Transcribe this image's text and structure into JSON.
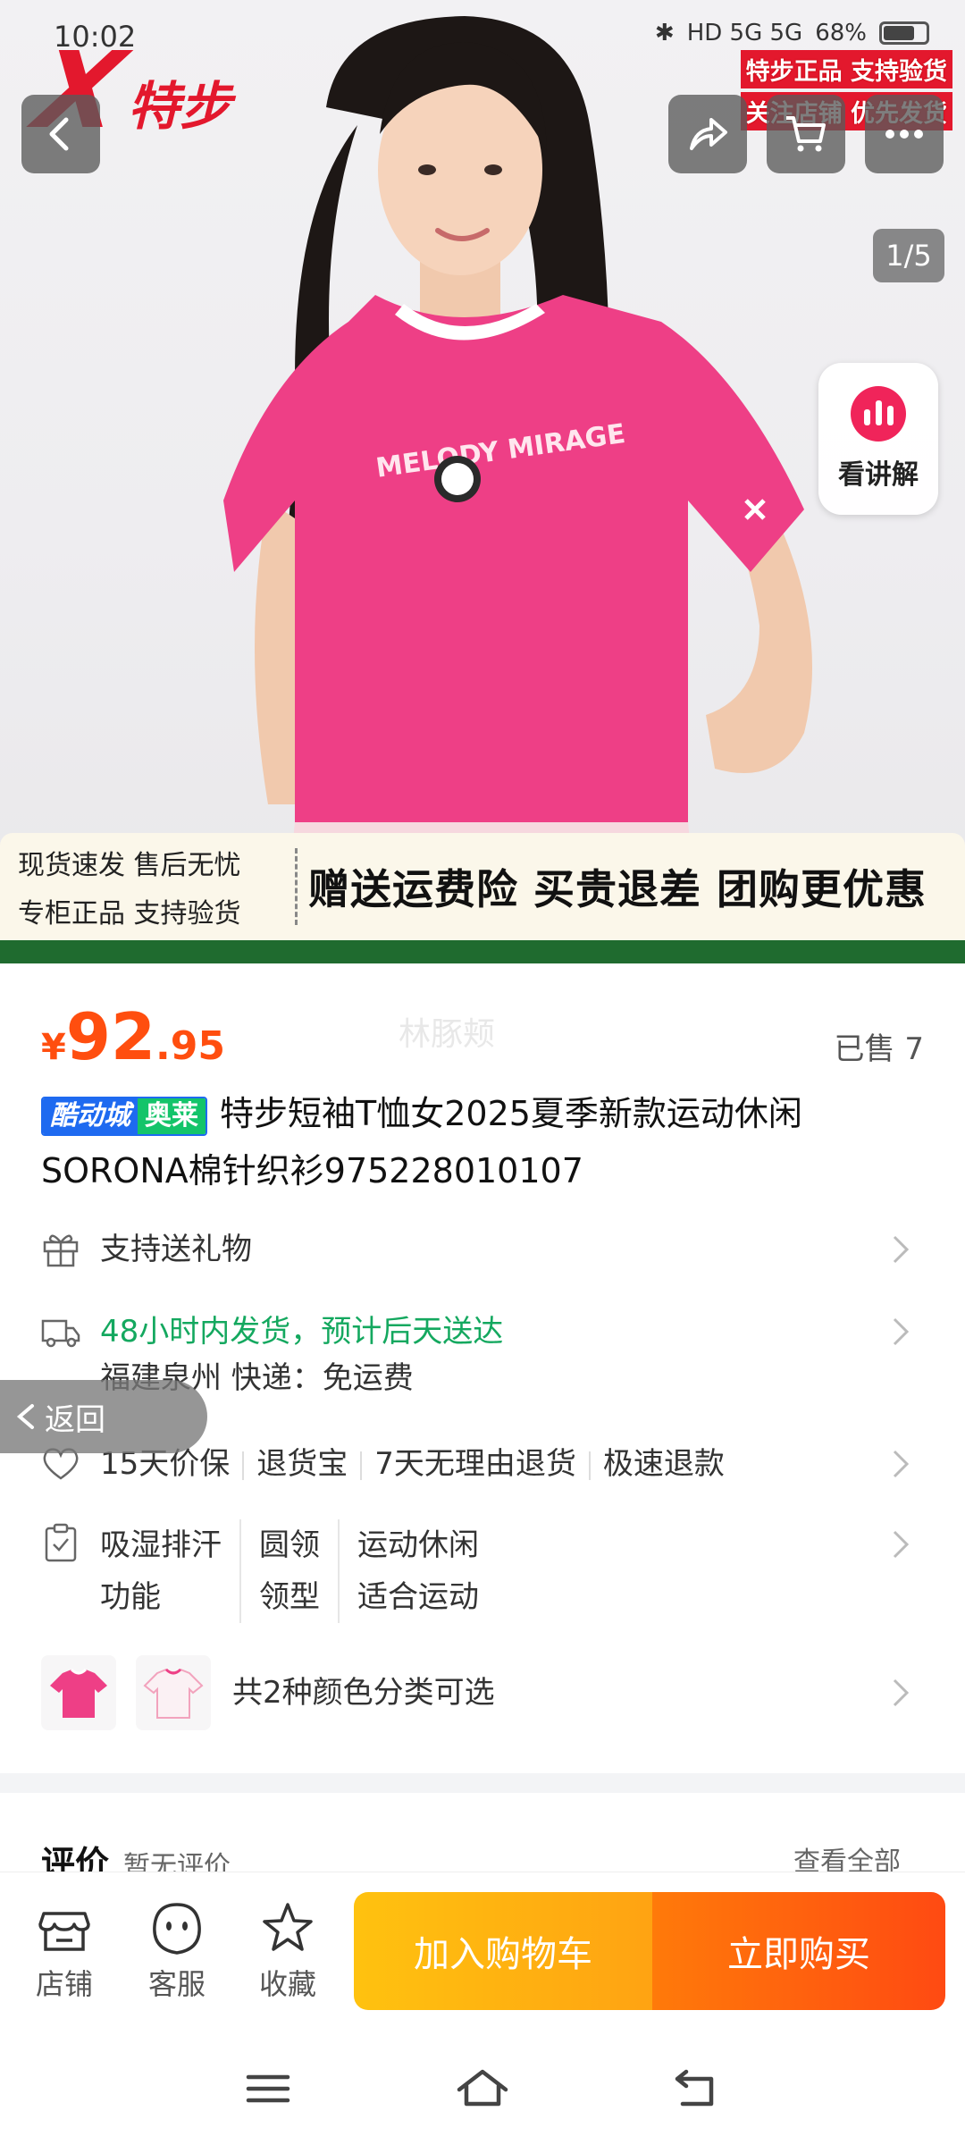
{
  "status_bar": {
    "time": "10:02",
    "left_icons": [
      "cat-icon",
      "app-e-icon",
      "alipay-icon",
      "app-badge-icon"
    ],
    "network": "HD 5G 5G",
    "battery": "68%"
  },
  "brand": {
    "logo_mark": "X",
    "logo_name": "特步",
    "color": "#e3182d"
  },
  "promo_badge": {
    "line1": "特步正品 支持验货",
    "line2": "关注店铺 优先发货"
  },
  "gallery": {
    "page_indicator": "1/5",
    "explain_label": "看讲解"
  },
  "guarantee": {
    "left_line1": "现货速发 售后无忧",
    "left_line2": "专柜正品 支持验货",
    "right_text": "赠送运费险 买贵退差 团购更优惠"
  },
  "product": {
    "price_symbol": "¥",
    "price_int": "92",
    "price_dec": ".95",
    "watermark": "林豚颊",
    "sold": "已售 7",
    "tag_a": "酷动城",
    "tag_b": "奥莱",
    "title": "特步短袖T恤女2025夏季新款运动休闲SORONA棉针织衫975228010107"
  },
  "rows": {
    "gift": "支持送礼物",
    "shipping_main": "48小时内发货，预计后天送达",
    "shipping_sub": "福建泉州 快递：免运费",
    "services": [
      "15天价保",
      "退货宝",
      "7天无理由退货",
      "极速退款"
    ],
    "attrs": [
      {
        "top": "吸湿排汗",
        "bottom": "功能"
      },
      {
        "top": "圆领",
        "bottom": "领型"
      },
      {
        "top": "运动休闲",
        "bottom": "适合运动"
      }
    ],
    "colors_text": "共2种颜色分类可选"
  },
  "review": {
    "title": "评价",
    "subtitle": "暂无评价",
    "view_all": "查看全部"
  },
  "back_pill": {
    "label": "返回"
  },
  "action_bar": {
    "store": "店铺",
    "service": "客服",
    "favorite": "收藏",
    "add_to_cart": "加入购物车",
    "buy_now": "立即购买"
  },
  "colors": {
    "price": "#ff4e0f",
    "shipping_green": "#14a85f",
    "cart_gradient": [
      "#ffc20f",
      "#ffa312"
    ],
    "buy_gradient": [
      "#ff7a0a",
      "#ff4a12"
    ],
    "shirt_pink": "#ee3f86"
  }
}
